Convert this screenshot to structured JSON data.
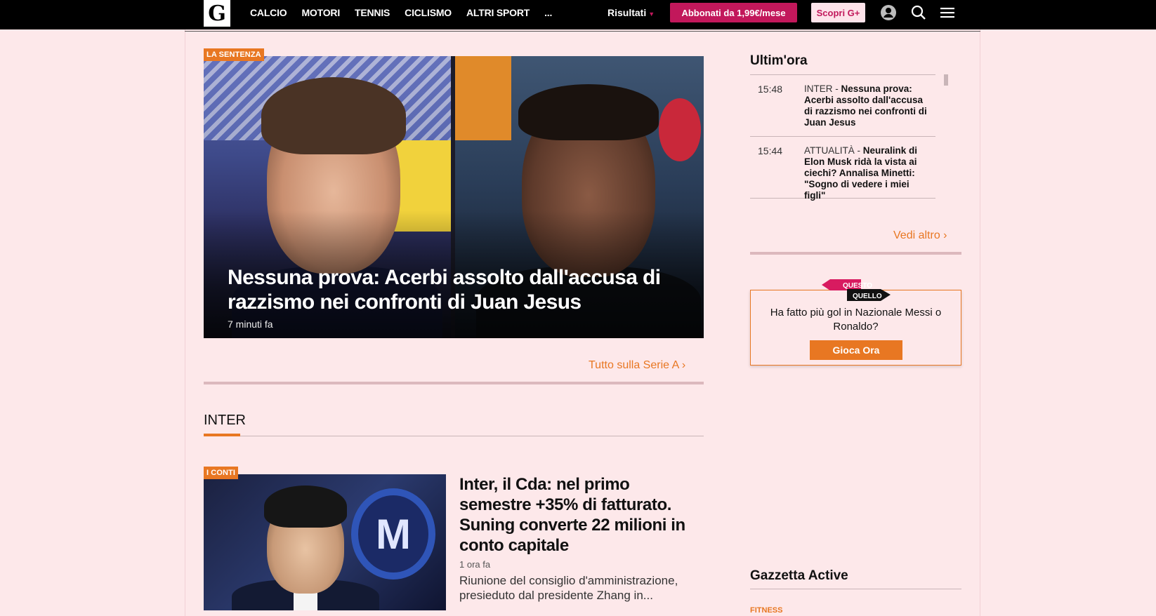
{
  "header": {
    "logo_text": "G",
    "nav": [
      "CALCIO",
      "MOTORI",
      "TENNIS",
      "CICLISMO",
      "ALTRI SPORT",
      "..."
    ],
    "results_label": "Risultati",
    "subscribe_label": "Abbonati da 1,99€/mese",
    "gplus_label": "Scopri G+",
    "icons": [
      "user-icon",
      "search-icon",
      "menu-icon"
    ]
  },
  "hero": {
    "tag": "LA SENTENZA",
    "title": "Nessuna prova: Acerbi assolto dall'accusa di razzismo nei confronti di Juan Jesus",
    "time": "7 minuti fa"
  },
  "serie_a_link": "Tutto sulla Serie A",
  "section": {
    "title": "INTER"
  },
  "article": {
    "tag": "I CONTI",
    "title": "Inter, il Cda: nel primo semestre +35% di fatturato. Suning converte 22 milioni in conto capitale",
    "time": "1 ora fa",
    "desc": "Riunione del consiglio d'amministrazione, presieduto dal presidente Zhang in..."
  },
  "sidebar": {
    "breaking_title": "Ultim'ora",
    "items": [
      {
        "time": "15:48",
        "category": "INTER - ",
        "headline": "Nessuna prova: Acerbi assolto dall'accusa di razzismo nei confronti di Juan Jesus"
      },
      {
        "time": "15:44",
        "category": "ATTUALITÀ - ",
        "headline": "Neuralink di Elon Musk ridà la vista ai ciechi? Annalisa Minetti: \"Sogno di vedere i miei figli\""
      }
    ],
    "more_label": "Vedi altro",
    "quiz": {
      "logo_top": "QUESTO",
      "logo_bottom": "QUELLO",
      "question": "Ha fatto più gol in Nazionale Messi o Ronaldo?",
      "button": "Gioca Ora"
    },
    "active_title": "Gazzetta Active",
    "active_category": "FITNESS"
  },
  "colors": {
    "accent": "#e87722",
    "brand_pink": "#c2185b",
    "page_bg": "#fde8ea",
    "topbar": "#000000"
  }
}
